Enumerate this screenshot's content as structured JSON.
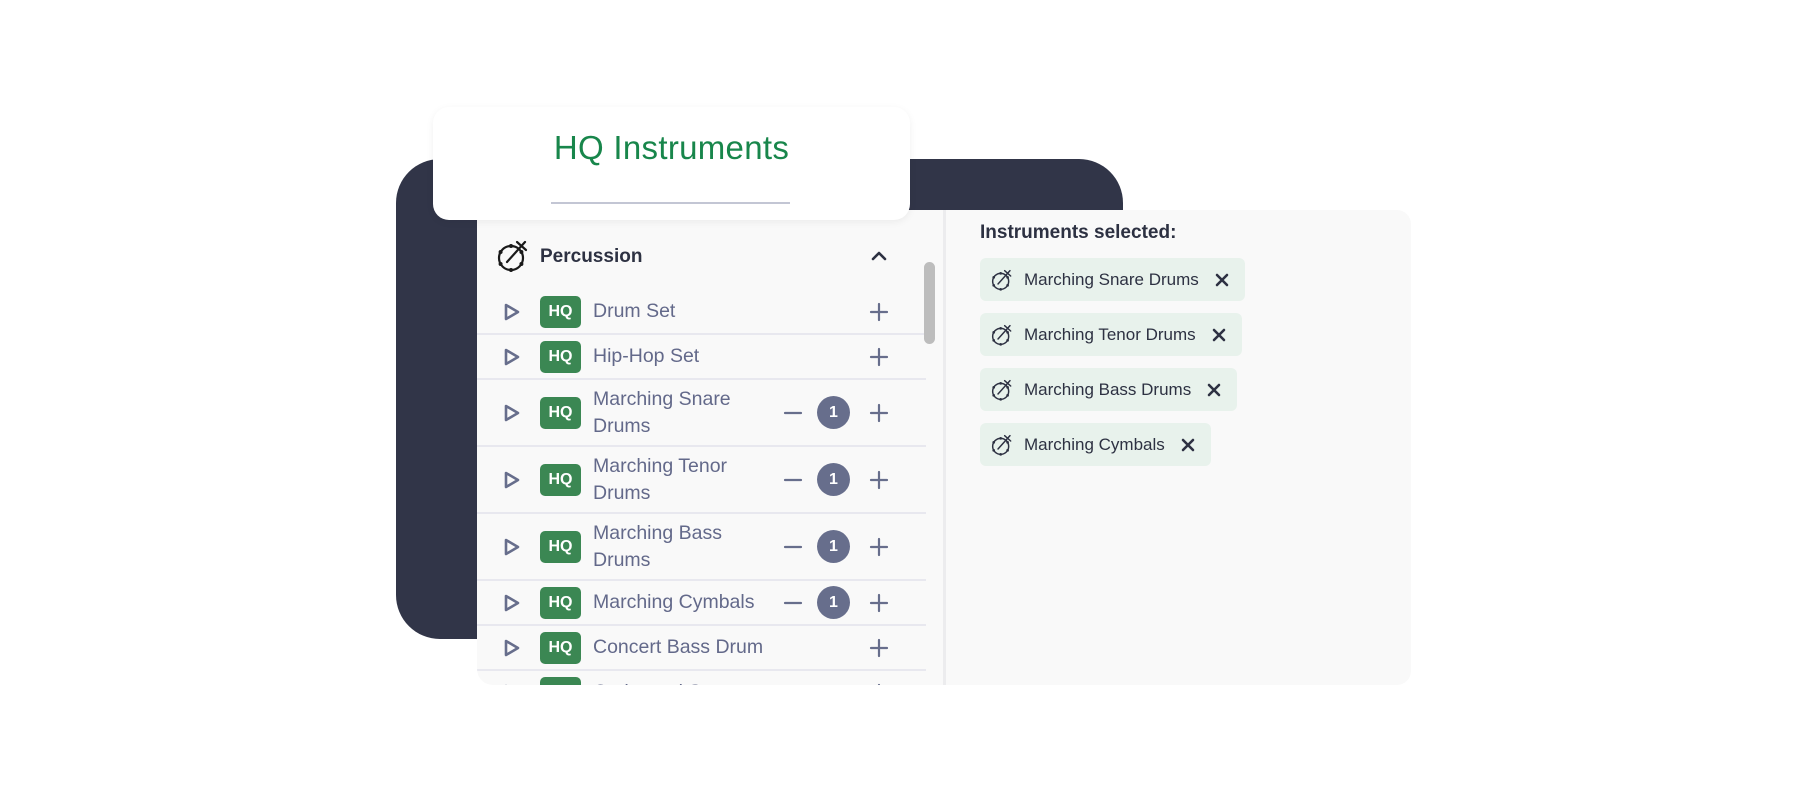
{
  "header": {
    "title": "HQ Instruments"
  },
  "group": {
    "label": "Percussion",
    "icon": "drum-icon",
    "expanded": true
  },
  "instruments": [
    {
      "name": "Drum Set",
      "badge": "HQ",
      "count": null
    },
    {
      "name": "Hip-Hop Set",
      "badge": "HQ",
      "count": null
    },
    {
      "name": "Marching Snare Drums",
      "badge": "HQ",
      "count": "1"
    },
    {
      "name": "Marching Tenor Drums",
      "badge": "HQ",
      "count": "1"
    },
    {
      "name": "Marching Bass Drums",
      "badge": "HQ",
      "count": "1"
    },
    {
      "name": "Marching Cymbals",
      "badge": "HQ",
      "count": "1"
    },
    {
      "name": "Concert Bass Drum",
      "badge": "HQ",
      "count": null
    },
    {
      "name": "Orchestral S...",
      "badge": "HQ",
      "count": null
    }
  ],
  "selected": {
    "title": "Instruments selected:",
    "items": [
      {
        "name": "Marching Snare Drums"
      },
      {
        "name": "Marching Tenor Drums"
      },
      {
        "name": "Marching Bass Drums"
      },
      {
        "name": "Marching Cymbals"
      }
    ]
  },
  "colors": {
    "accent_green": "#18864b",
    "badge_green": "#3b8753",
    "dark_bg": "#313548",
    "count_badge": "#676e8c",
    "chip_bg": "#e8f2ec"
  }
}
